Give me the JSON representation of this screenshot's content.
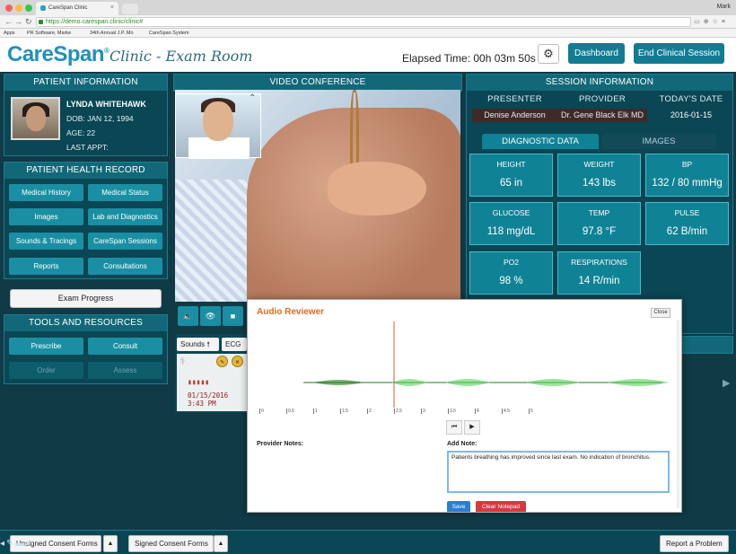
{
  "browser": {
    "tab_title": "CareSpan Clinic",
    "tab_close": "×",
    "user": "Mark",
    "url": "https://demo.carespan.clinic/clinic#",
    "bookmarks": [
      "Apps",
      "PR Software, Marke",
      "34th Annual J.P. Mo",
      "CareSpan System"
    ]
  },
  "header": {
    "logo": "CareSpan",
    "logo_mark": "®",
    "subtitle": "Clinic - Exam Room",
    "elapsed": "Elapsed Time: 00h 03m 50s",
    "settings_icon": "⚙",
    "dashboard": "Dashboard",
    "end_session": "End Clinical Session"
  },
  "patient": {
    "title": "PATIENT INFORMATION",
    "name": "LYNDA WHITEHAWK",
    "dob": "DOB: JAN 12, 1994",
    "age": "AGE: 22",
    "last_appt": "LAST APPT:"
  },
  "health_record": {
    "title": "PATIENT HEALTH RECORD",
    "items": [
      "Medical History",
      "Medical Status",
      "Images",
      "Lab and Diagnostics",
      "Sounds & Tracings",
      "CareSpan Sessions",
      "Reports",
      "Consultations"
    ]
  },
  "exam_progress": "Exam Progress",
  "tools": {
    "title": "TOOLS AND RESOURCES",
    "prescribe": "Prescribe",
    "consult": "Consult",
    "order": "Order",
    "assess": "Assess"
  },
  "video": {
    "title": "VIDEO CONFERENCE",
    "pip_toggle": "⌃",
    "controls": [
      "🔈",
      "👁",
      "■"
    ]
  },
  "sounds": {
    "tab_sounds": "Sounds",
    "tab_sounds_icon": "🠕",
    "tab_ecg": "ECG",
    "date": "01/15/2016",
    "time": "3:43 PM"
  },
  "session": {
    "title": "SESSION INFORMATION",
    "presenter_label": "PRESENTER",
    "provider_label": "PROVIDER",
    "date_label": "TODAY'S DATE",
    "presenter": "Denise Anderson",
    "provider": "Dr. Gene Black Elk MD",
    "date": "2016-01-15"
  },
  "diagnostic": {
    "tab_data": "DIAGNOSTIC DATA",
    "tab_images": "IMAGES",
    "vitals": [
      {
        "label": "HEIGHT",
        "value": "65 in"
      },
      {
        "label": "WEIGHT",
        "value": "143 lbs"
      },
      {
        "label": "BP",
        "value": "132 / 80 mmHg"
      },
      {
        "label": "GLUCOSE",
        "value": "118 mg/dL"
      },
      {
        "label": "TEMP",
        "value": "97.8 °F"
      },
      {
        "label": "PULSE",
        "value": "62 B/min"
      },
      {
        "label": "PO2",
        "value": "98 %"
      },
      {
        "label": "RESPIRATIONS",
        "value": "14 R/min"
      }
    ]
  },
  "audio_reviewer": {
    "title": "Audio Reviewer",
    "close": "Close",
    "ticks": [
      "0",
      "0.5",
      "1",
      "1.5",
      "2",
      "2.5",
      "3",
      "3.5",
      "4",
      "4.5",
      "5"
    ],
    "playhead": 2.5,
    "skip_back": "⏮",
    "play": "▶",
    "provider_notes_label": "Provider Notes:",
    "add_note_label": "Add Note:",
    "note_text": "Patients breathing has improved since last exam. No indication of bronchitus.",
    "save": "Save",
    "clear": "Clear Notepad",
    "colors": {
      "wave": "#5ad35a",
      "wave_dark": "#1f7a1f",
      "playhead": "#e05a40"
    }
  },
  "footer": {
    "unsigned": "Unsigned Consent Forms",
    "signed": "Signed Consent Forms",
    "caret": "▲",
    "report": "Report a Problem"
  }
}
